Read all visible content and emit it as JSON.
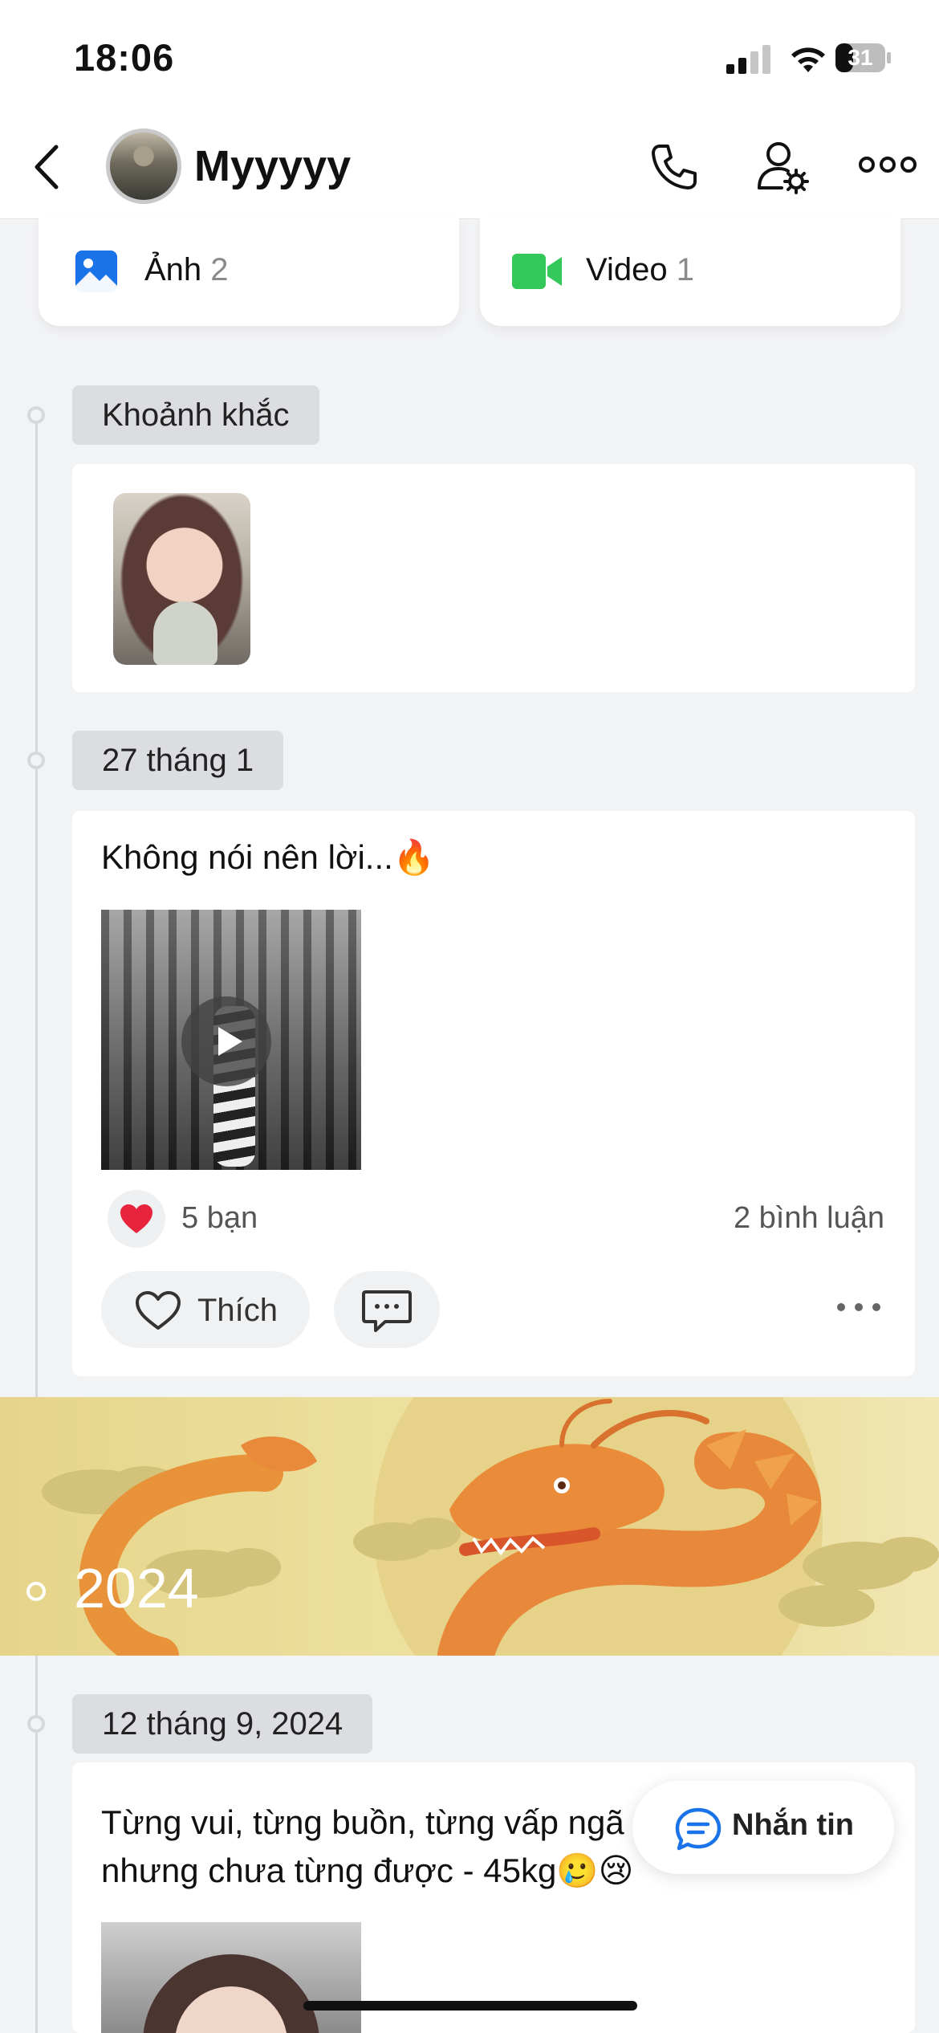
{
  "status_bar": {
    "time": "18:06",
    "battery": "31"
  },
  "header": {
    "name": "Myyyyy"
  },
  "media": {
    "photos_label": "Ảnh",
    "photos_count": "2",
    "videos_label": "Video",
    "videos_count": "1"
  },
  "timeline": {
    "moments_label": "Khoảnh khắc",
    "post1": {
      "date": "27 tháng 1",
      "text": "Không nói nên lời...🔥",
      "reactions": "5 bạn",
      "comments": "2 bình luận",
      "like_label": "Thích"
    },
    "year_banner": "2024",
    "post2": {
      "date": "12 tháng 9, 2024",
      "text_line1": "Từng vui, từng buồn, từng vấp ngã",
      "text_line2": "nhưng chưa từng được - 45kg🥲😢"
    }
  },
  "fab": {
    "label": "Nhắn tin"
  },
  "colors": {
    "accent": "#1a73e8",
    "video_green": "#34c759",
    "heart": "#e8233d"
  }
}
